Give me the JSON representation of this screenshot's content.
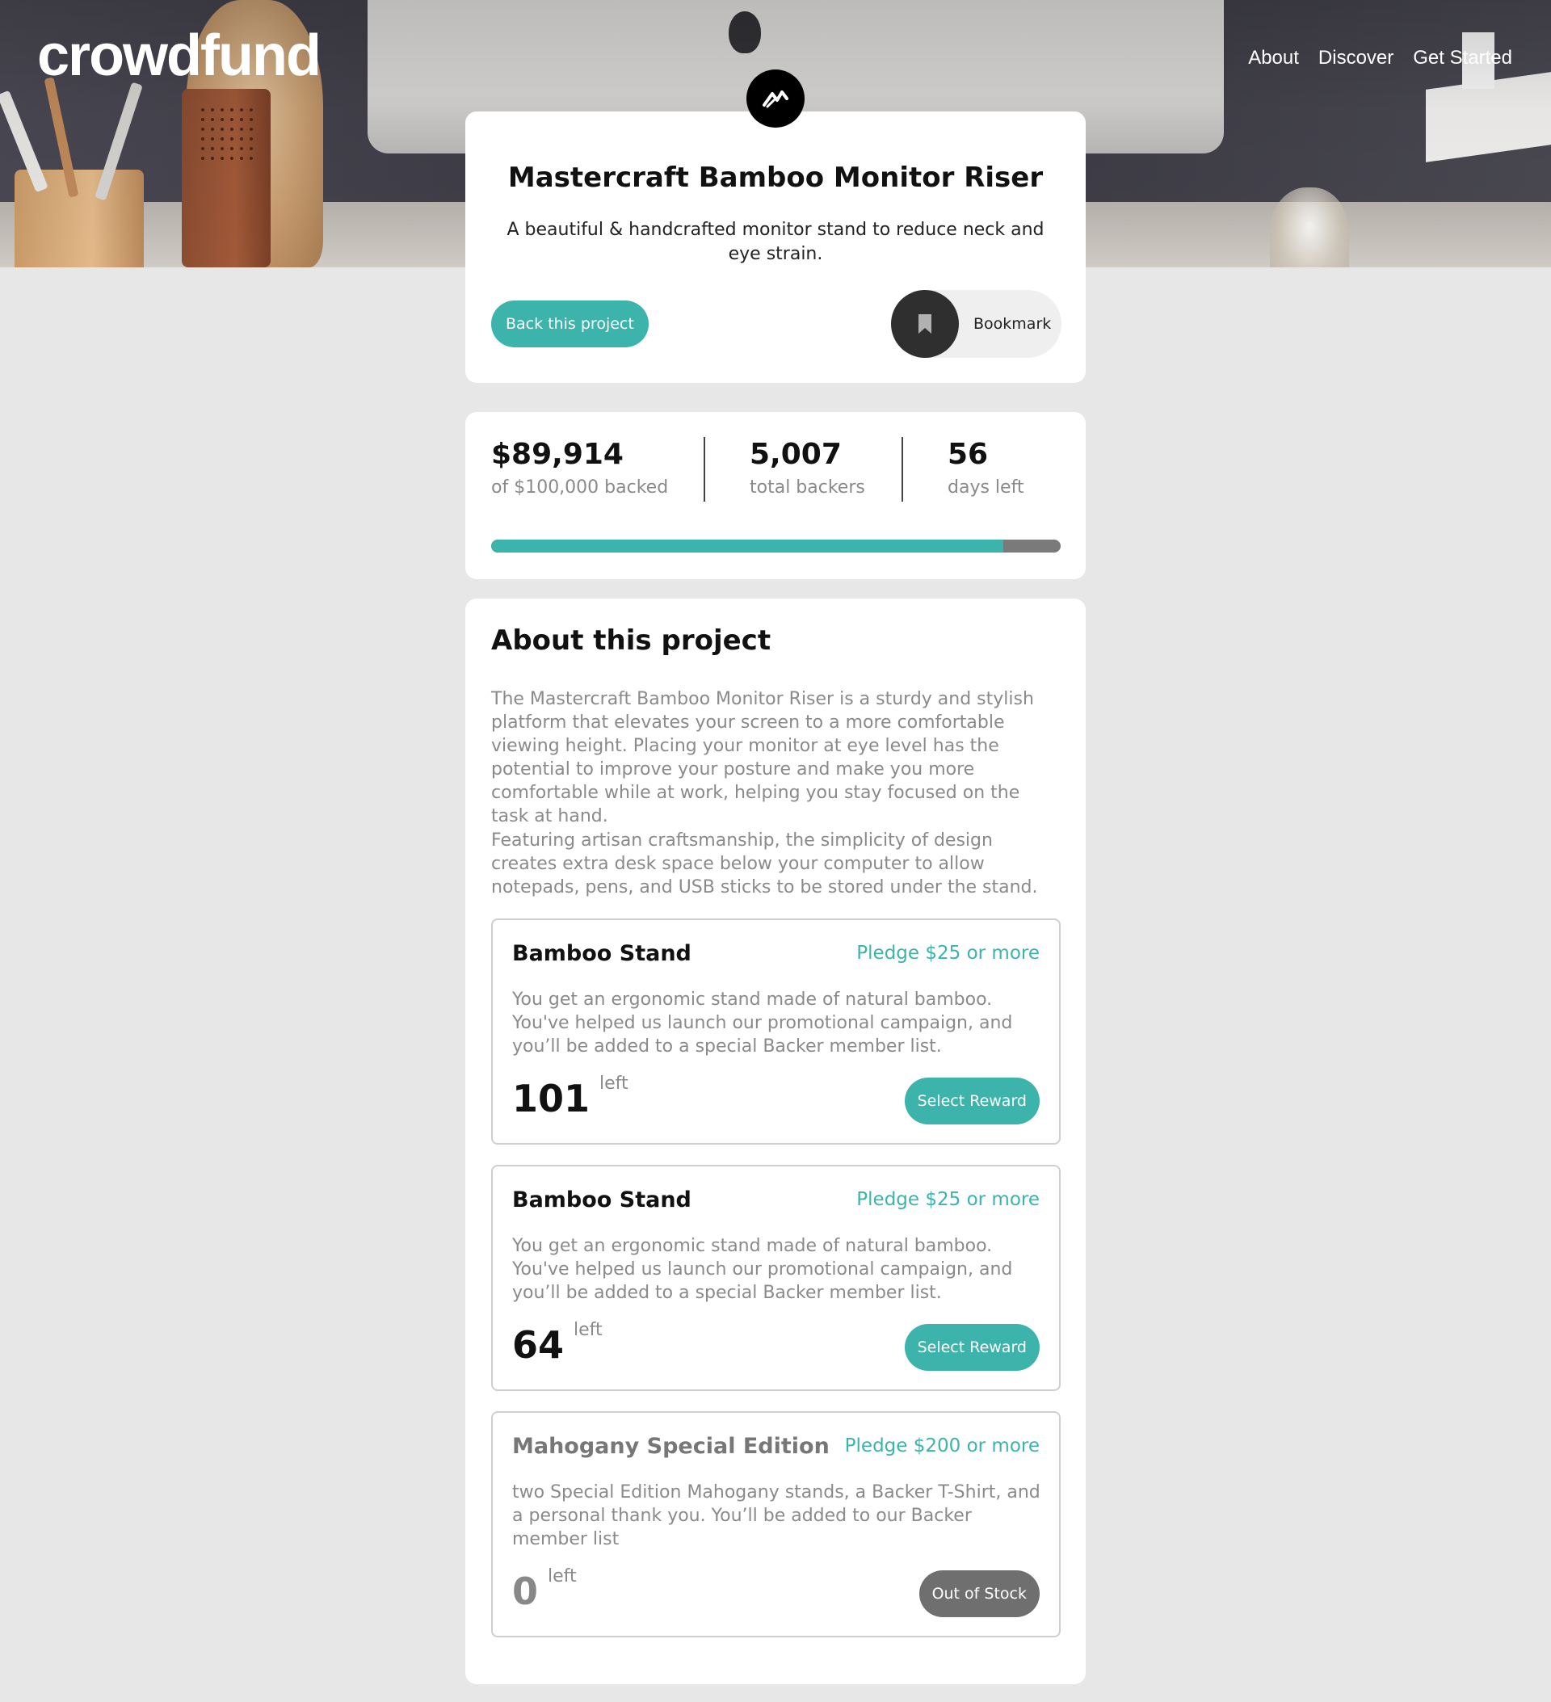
{
  "header": {
    "logo": "crowdfund",
    "nav": [
      "About",
      "Discover",
      "Get Started"
    ]
  },
  "project": {
    "title": "Mastercraft Bamboo Monitor Riser",
    "subtitle": "A beautiful & handcrafted monitor stand to reduce neck and eye strain.",
    "back_label": "Back this project",
    "bookmark_label": "Bookmark"
  },
  "stats": {
    "backed_amount": "$89,914",
    "backed_label": "of $100,000 backed",
    "backers": "5,007",
    "backers_label": "total backers",
    "days": "56",
    "days_label": "days left",
    "progress_fraction": 0.899
  },
  "about": {
    "title": "About this project",
    "paragraphs": [
      "The Mastercraft Bamboo Monitor Riser is a sturdy and stylish platform that elevates your screen to a more comfortable viewing height. Placing your monitor at eye level has the potential to improve your posture and make you more comfortable while at work, helping you stay focused on the task at hand.",
      "Featuring artisan craftsmanship, the simplicity of design creates extra desk space below your computer to allow notepads, pens, and USB sticks to be stored under the stand."
    ]
  },
  "rewards": [
    {
      "name": "Bamboo Stand",
      "pledge": "Pledge $25 or more",
      "description": "You get an ergonomic stand made of natural bamboo. You've helped us launch our promotional campaign, and you’ll be added to a special Backer member list.",
      "qty": "101",
      "left_label": "left",
      "button": "Select Reward"
    },
    {
      "name": "Bamboo Stand",
      "pledge": "Pledge $25 or more",
      "description": "You get an ergonomic stand made of natural bamboo. You've helped us launch our promotional campaign, and you’ll be added to a special Backer member list.",
      "qty": "64",
      "left_label": "left",
      "button": "Select Reward"
    },
    {
      "name": "Mahogany Special Edition",
      "pledge": "Pledge $200 or more",
      "description": "two Special Edition Mahogany stands, a Backer T-Shirt, and a personal thank you. You’ll be added to our Backer member list",
      "qty": "0",
      "left_label": "left",
      "button": "Out of Stock"
    }
  ],
  "colors": {
    "accent": "#3cb3ab",
    "page_bg": "#e7e7e7",
    "muted_text": "#8a8a8a",
    "disabled_button": "#6f6f6f"
  },
  "icons": {
    "project_logo": "mastercraft-logo-icon",
    "bookmark": "bookmark-icon"
  }
}
